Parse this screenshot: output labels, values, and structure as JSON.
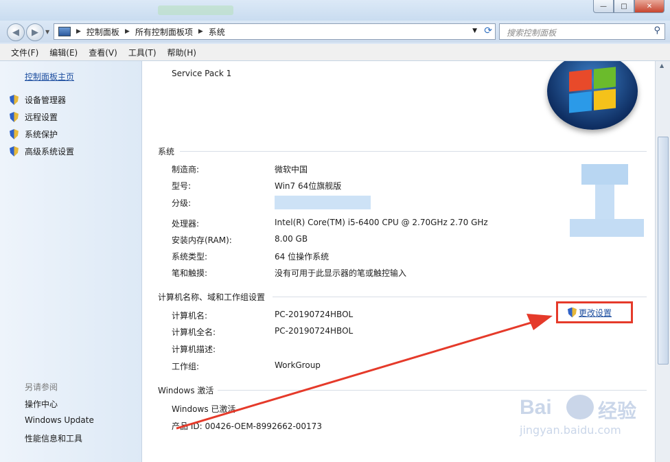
{
  "window": {
    "min_label": "—",
    "max_label": "□",
    "close_label": "✕"
  },
  "nav": {
    "back_glyph": "◀",
    "forward_glyph": "▶",
    "breadcrumbs": [
      "控制面板",
      "所有控制面板项",
      "系统"
    ],
    "search_placeholder": "搜索控制面板"
  },
  "menu": [
    "文件(F)",
    "编辑(E)",
    "查看(V)",
    "工具(T)",
    "帮助(H)"
  ],
  "sidebar": {
    "home": "控制面板主页",
    "items": [
      "设备管理器",
      "远程设置",
      "系统保护",
      "高级系统设置"
    ],
    "see_also_title": "另请参阅",
    "see_also": [
      "操作中心",
      "Windows Update",
      "性能信息和工具"
    ]
  },
  "edition": {
    "service_pack": "Service Pack 1"
  },
  "system": {
    "title": "系统",
    "rows": [
      {
        "label": "制造商:",
        "value": "微软中国"
      },
      {
        "label": "型号:",
        "value": "Win7 64位旗舰版"
      },
      {
        "label": "分级:",
        "value": ""
      },
      {
        "label": "处理器:",
        "value": "Intel(R) Core(TM) i5-6400 CPU @ 2.70GHz   2.70 GHz"
      },
      {
        "label": "安装内存(RAM):",
        "value": "8.00 GB"
      },
      {
        "label": "系统类型:",
        "value": "64 位操作系统"
      },
      {
        "label": "笔和触摸:",
        "value": "没有可用于此显示器的笔或触控输入"
      }
    ]
  },
  "computer": {
    "title": "计算机名称、域和工作组设置",
    "change_label": "更改设置",
    "rows": [
      {
        "label": "计算机名:",
        "value": "PC-20190724HBOL"
      },
      {
        "label": "计算机全名:",
        "value": "PC-20190724HBOL"
      },
      {
        "label": "计算机描述:",
        "value": ""
      },
      {
        "label": "工作组:",
        "value": "WorkGroup"
      }
    ]
  },
  "activation": {
    "title": "Windows 激活",
    "status": "Windows 已激活",
    "product_id": "产品 ID: 00426-OEM-8992662-00173"
  },
  "watermark": {
    "brand": "Bai",
    "brand2": "经验",
    "url": "jingyan.baidu.com"
  },
  "colors": {
    "accent_red": "#e53a2a",
    "link_blue": "#1e4fa0"
  }
}
